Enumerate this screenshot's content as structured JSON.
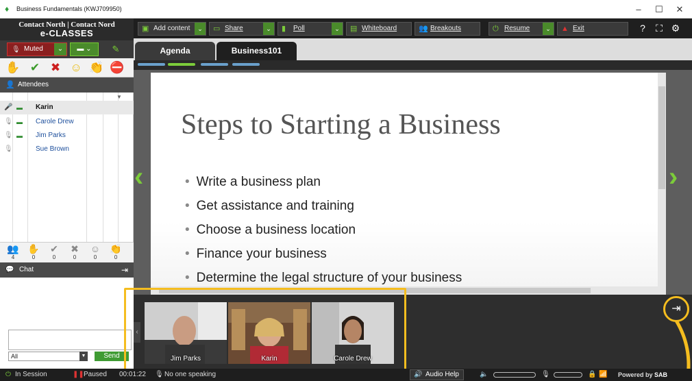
{
  "window": {
    "title": "Business Fundamentals (KWJ709950)",
    "controls": [
      "–",
      "☐",
      "✕"
    ]
  },
  "brand": {
    "line1": "Contact North | Contact Nord",
    "line2": "e-CLASSES"
  },
  "left_controls": {
    "muted_label": "Muted"
  },
  "attendees": {
    "header": "Attendees",
    "list": [
      {
        "name": "Karin",
        "mic": "on"
      },
      {
        "name": "Carole Drew",
        "mic": "muted"
      },
      {
        "name": "Jim Parks",
        "mic": "muted"
      },
      {
        "name": "Sue Brown",
        "mic": "muted"
      }
    ],
    "stats": [
      {
        "icon": "people",
        "count": "4"
      },
      {
        "icon": "hand",
        "count": "0"
      },
      {
        "icon": "check",
        "count": "0"
      },
      {
        "icon": "x",
        "count": "0"
      },
      {
        "icon": "smile",
        "count": "0"
      },
      {
        "icon": "clap",
        "count": "0"
      }
    ]
  },
  "chat": {
    "header": "Chat",
    "audience": "All",
    "send_label": "Send",
    "input_value": ""
  },
  "toolbar": {
    "add_content": "Add content",
    "share": "Share",
    "poll": "Poll",
    "whiteboard": "Whiteboard",
    "breakouts": "Breakouts",
    "resume": "Resume",
    "exit": "Exit"
  },
  "tabs": [
    {
      "label": "Agenda",
      "active": false
    },
    {
      "label": "Business101",
      "active": true
    }
  ],
  "slide": {
    "title": "Steps to Starting a Business",
    "bullets": [
      "Write a business plan",
      "Get assistance and training",
      "Choose a business location",
      "Finance your business",
      "Determine the legal structure of your business"
    ]
  },
  "videos": [
    {
      "name": "Jim Parks"
    },
    {
      "name": "Karin"
    },
    {
      "name": "Carole Drew"
    }
  ],
  "status": {
    "session": "In Session",
    "paused": "Paused",
    "timer": "00:01:22",
    "speaking": "No one speaking",
    "audio_help": "Audio Help",
    "powered": "Powered by",
    "powered_brand": "SAB"
  },
  "colors": {
    "accent": "#7ccc3a",
    "muted": "#8b1f1f",
    "highlight": "#f5bd1f",
    "tab_active": "#1f1f1f"
  }
}
